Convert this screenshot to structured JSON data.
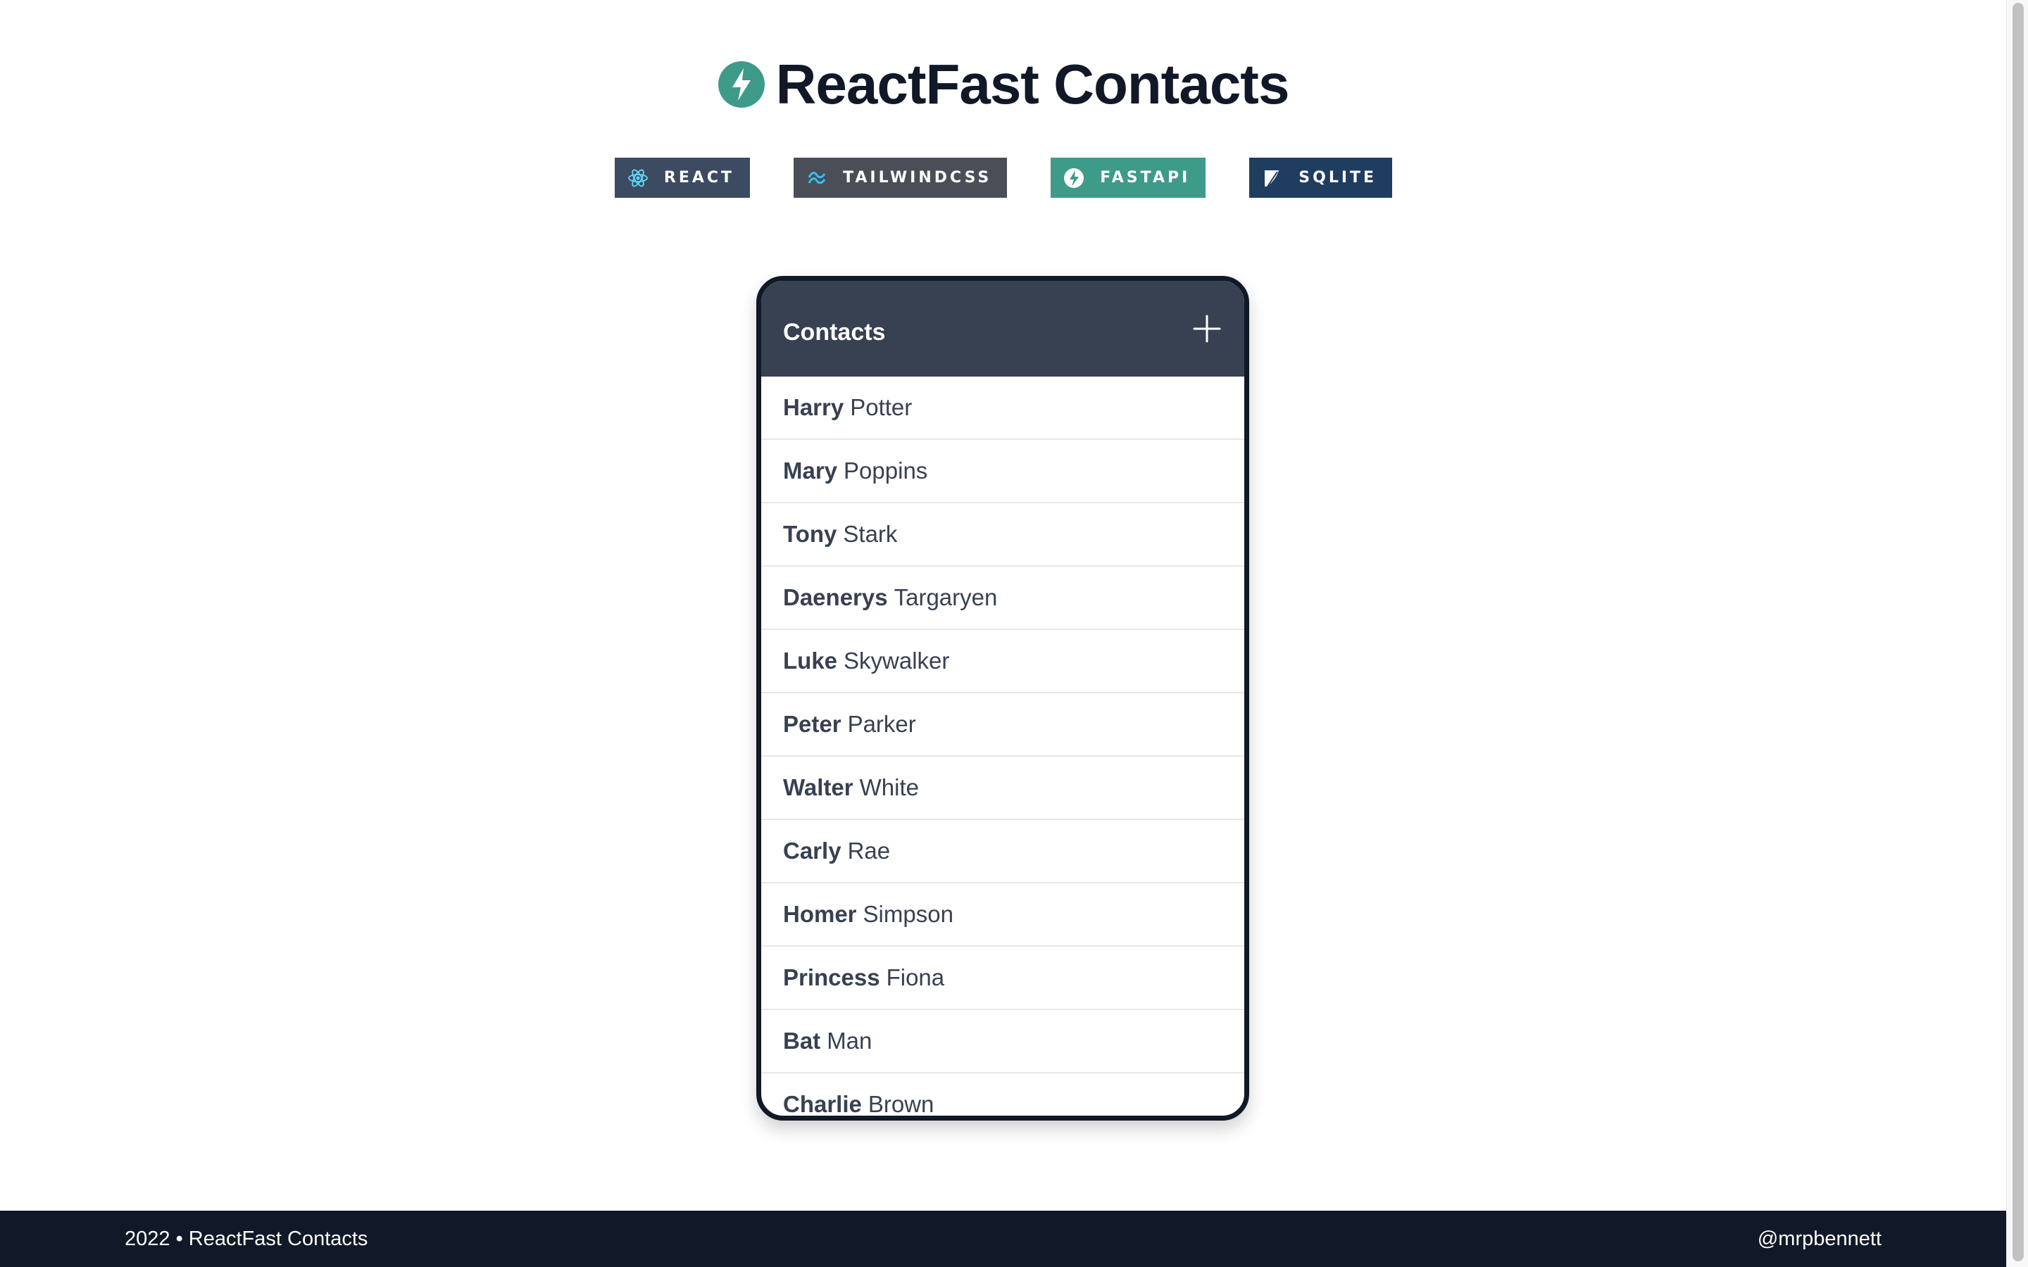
{
  "header": {
    "logo_icon": "bolt-circle-icon",
    "title": "ReactFast Contacts"
  },
  "badges": [
    {
      "label": "REACT",
      "icon": "react-atom-icon",
      "color": "#3c4a62"
    },
    {
      "label": "TAILWINDCSS",
      "icon": "tailwind-wave-icon",
      "color": "#4a4f57"
    },
    {
      "label": "FASTAPI",
      "icon": "fastapi-bolt-icon",
      "color": "#3e9a89"
    },
    {
      "label": "SQLITE",
      "icon": "sqlite-feather-icon",
      "color": "#1f3d5e"
    }
  ],
  "contacts_panel": {
    "title": "Contacts",
    "add_icon": "plus-icon",
    "contacts": [
      {
        "first": "Harry",
        "last": "Potter"
      },
      {
        "first": "Mary",
        "last": "Poppins"
      },
      {
        "first": "Tony",
        "last": "Stark"
      },
      {
        "first": "Daenerys",
        "last": "Targaryen"
      },
      {
        "first": "Luke",
        "last": "Skywalker"
      },
      {
        "first": "Peter",
        "last": "Parker"
      },
      {
        "first": "Walter",
        "last": "White"
      },
      {
        "first": "Carly",
        "last": "Rae"
      },
      {
        "first": "Homer",
        "last": "Simpson"
      },
      {
        "first": "Princess",
        "last": "Fiona"
      },
      {
        "first": "Bat",
        "last": "Man"
      },
      {
        "first": "Charlie",
        "last": "Brown"
      }
    ]
  },
  "footer": {
    "left": "2022 • ReactFast Contacts",
    "right": "@mrpbennett"
  },
  "colors": {
    "accent": "#3e9a89",
    "panel_header": "#374151",
    "footer_bg": "#111827"
  }
}
